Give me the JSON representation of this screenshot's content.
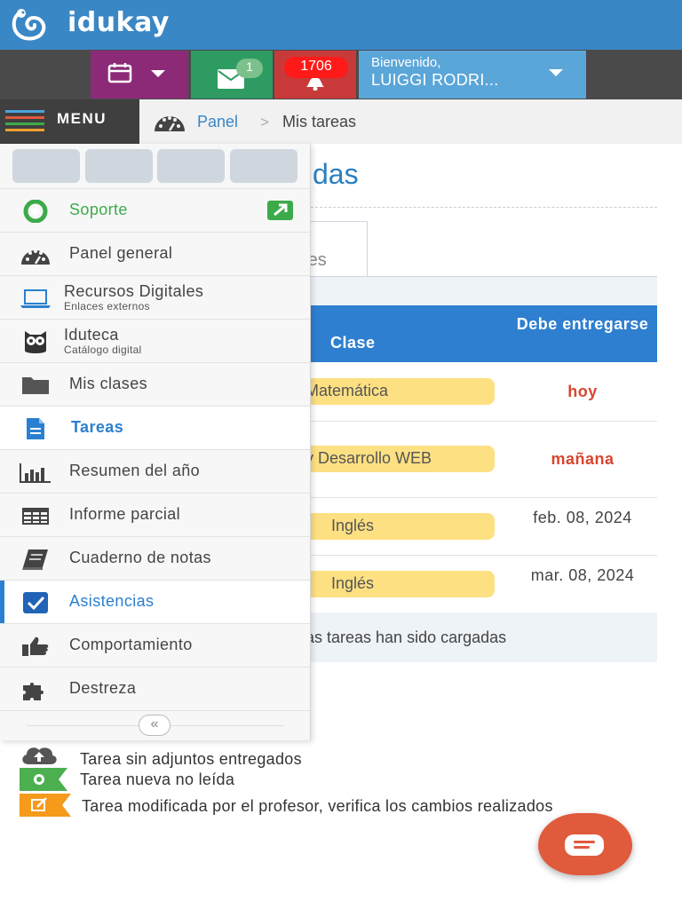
{
  "app": {
    "brand": "idukay"
  },
  "header": {
    "messages_badge": "1",
    "notifications_badge": "1706",
    "user_greeting": "Bienvenido,",
    "user_name": "LUIGGI RODRI..."
  },
  "nav": {
    "menu_label": "MENU",
    "breadcrumb": {
      "home": "Panel",
      "separator": ">",
      "current": "Mis tareas"
    }
  },
  "main": {
    "title_fragment": "das",
    "tab_fragment": "res",
    "table": {
      "col_clase": "Clase",
      "col_debe": "Debe entregarse",
      "rows": [
        {
          "clase": "Matemática",
          "debe": "hoy"
        },
        {
          "clase": "y Desarrollo WEB",
          "debe": "mañana"
        },
        {
          "clase": "Inglés",
          "debe": "feb. 08, 2024"
        },
        {
          "clase": "Inglés",
          "debe": "mar. 08, 2024"
        }
      ],
      "footer": "las tareas han sido cargadas"
    },
    "legend": [
      {
        "icon": "cloud-upload-icon",
        "text": "Tarea sin adjuntos entregados"
      },
      {
        "icon": "new-badge-icon",
        "text": "Tarea nueva no leída"
      },
      {
        "icon": "edit-icon",
        "text": "Tarea modificada por el profesor, verifica los cambios realizados"
      }
    ]
  },
  "sidebar": {
    "items": [
      {
        "label": "Soporte",
        "icon": "lifebuoy-icon"
      },
      {
        "label": "Panel general",
        "icon": "dashboard-icon"
      },
      {
        "label": "Recursos Digitales",
        "sub": "Enlaces externos",
        "icon": "laptop-icon"
      },
      {
        "label": "Iduteca",
        "sub": "Catálogo digital",
        "icon": "owl-icon"
      },
      {
        "label": "Mis clases",
        "icon": "folder-icon"
      },
      {
        "label": "Tareas",
        "icon": "document-icon"
      },
      {
        "label": "Resumen del año",
        "icon": "bar-chart-icon"
      },
      {
        "label": "Informe parcial",
        "icon": "table-icon"
      },
      {
        "label": "Cuaderno de notas",
        "icon": "notebook-icon"
      },
      {
        "label": "Asistencias",
        "icon": "checkbox-icon"
      },
      {
        "label": "Comportamiento",
        "icon": "thumbs-up-icon"
      },
      {
        "label": "Destreza",
        "icon": "puzzle-icon"
      }
    ],
    "collapse": "«"
  },
  "colors": {
    "topbar": "#3a87c6",
    "calendar": "#8c2a78",
    "messages": "#2e9b63",
    "notifications": "#c83a3a",
    "user": "#5ba6d8",
    "accent": "#2a7fc1",
    "due_red": "#d9452f",
    "pill": "#fde082"
  }
}
